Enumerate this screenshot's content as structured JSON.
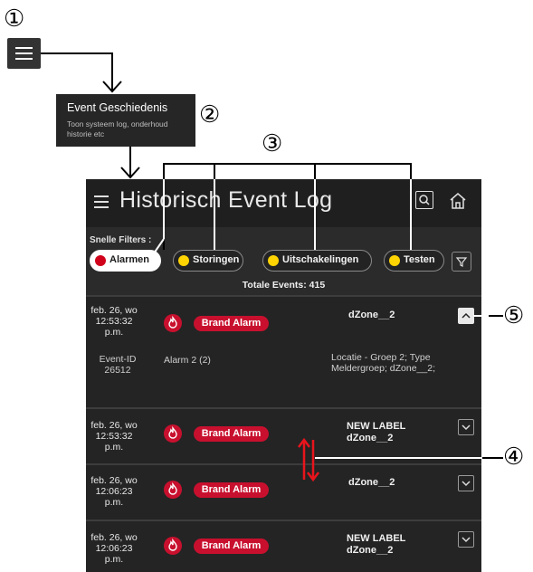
{
  "markers": {
    "m1": "①",
    "m2": "②",
    "m3": "③",
    "m4": "④",
    "m5": "⑤"
  },
  "menu_popup": {
    "title": "Event Geschiedenis",
    "description": "Toon systeem log, onderhoud historie etc"
  },
  "app": {
    "title": "Historisch Event Log",
    "filters_label": "Snelle Filters :",
    "filters": [
      {
        "label": "Alarmen",
        "color": "#d0021b",
        "active": true
      },
      {
        "label": "Storingen",
        "color": "#ffd400",
        "active": false
      },
      {
        "label": "Uitschakelingen",
        "color": "#ffd400",
        "active": false
      },
      {
        "label": "Testen",
        "color": "#ffd400",
        "active": false
      }
    ],
    "total_events": "Totale Events: 415",
    "events": [
      {
        "date": [
          "feb. 26, wo",
          "12:53:32",
          "p.m."
        ],
        "type": "Brand Alarm",
        "zone": [
          "dZone__2"
        ],
        "expanded": true,
        "details": {
          "id_label": "Event-ID",
          "id_value": "26512",
          "name": "Alarm 2 (2)",
          "location": [
            "Locatie - Groep 2; Type",
            "Meldergroep; dZone__2;"
          ]
        }
      },
      {
        "date": [
          "feb. 26, wo",
          "12:53:32",
          "p.m."
        ],
        "type": "Brand Alarm",
        "zone": [
          "NEW LABEL",
          "dZone__2"
        ],
        "expanded": false
      },
      {
        "date": [
          "feb. 26, wo",
          "12:06:23",
          "p.m."
        ],
        "type": "Brand Alarm",
        "zone": [
          "dZone__2"
        ],
        "expanded": false
      },
      {
        "date": [
          "feb. 26, wo",
          "12:06:23",
          "p.m."
        ],
        "type": "Brand Alarm",
        "zone": [
          "NEW LABEL",
          "dZone__2"
        ],
        "expanded": false
      }
    ]
  },
  "colors": {
    "alarm_red": "#c8102e",
    "sort_arrow_red": "#e8141c"
  }
}
